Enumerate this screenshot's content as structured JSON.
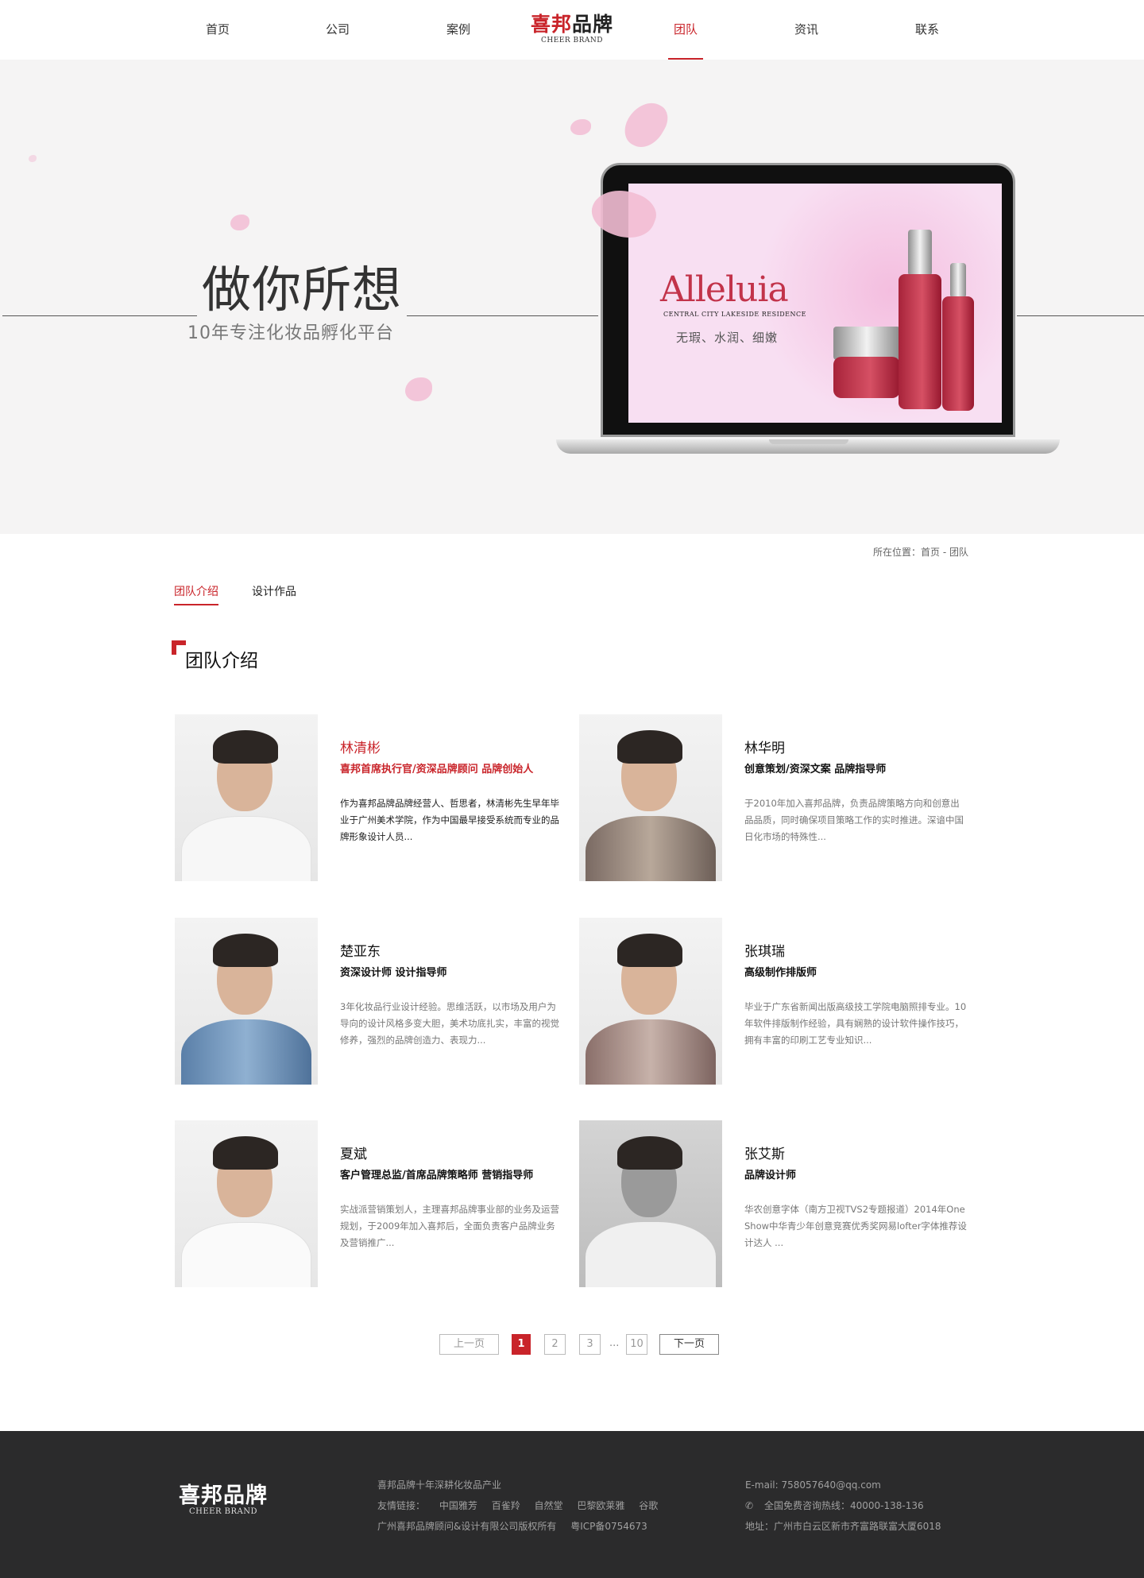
{
  "nav": {
    "items": [
      "首页",
      "公司",
      "案例",
      "团队",
      "资讯",
      "联系"
    ],
    "active_index": 3,
    "logo_cn_red": "喜邦",
    "logo_cn_dark": "品牌",
    "logo_en": "CHEER BRAND"
  },
  "hero": {
    "slogan": "做你所想",
    "subtitle": "10年专注化妆品孵化平台",
    "screen_brand": "Alleluia",
    "screen_subline": "CENTRAL CITY LAKESIDE RESIDENCE",
    "screen_tagline": "无瑕、水润、细嫩"
  },
  "breadcrumb": "所在位置：首页 - 团队",
  "tabs": [
    "团队介绍",
    "设计作品"
  ],
  "section_title": "团队介绍",
  "members": [
    {
      "name": "林清彬",
      "role": "喜邦首席执行官/资深品牌顾问  品牌创始人",
      "desc": "作为喜邦品牌品牌经营人、哲思者，林清彬先生早年毕业于广州美术学院，作为中国最早接受系统而专业的品牌形象设计人员..."
    },
    {
      "name": "林华明",
      "role": "创意策划/资深文案  品牌指导师",
      "desc": "于2010年加入喜邦品牌，负责品牌策略方向和创意出品品质，同时确保项目策略工作的实时推进。深谙中国日化市场的特殊性..."
    },
    {
      "name": "楚亚东",
      "role": "资深设计师  设计指导师",
      "desc": "3年化妆品行业设计经验。思维活跃，以市场及用户为导向的设计风格多变大胆，美术功底扎实，丰富的视觉修养，强烈的品牌创造力、表现力..."
    },
    {
      "name": "张琪瑞",
      "role": "高级制作排版师",
      "desc": "毕业于广东省新闻出版高级技工学院电脑照排专业。10年软件排版制作经验，具有娴熟的设计软件操作技巧，拥有丰富的印刷工艺专业知识..."
    },
    {
      "name": "夏斌",
      "role": "客户管理总监/首席品牌策略师  营销指导师",
      "desc": "实战派营销策划人，主理喜邦品牌事业部的业务及运营规划，于2009年加入喜邦后，全面负责客户品牌业务及营销推广..."
    },
    {
      "name": "张艾斯",
      "role": "品牌设计师",
      "desc": "华农创意字体（南方卫视TVS2专题报道）2014年One Show中华青少年创意竞赛优秀奖网易lofter字体推荐设计达人 ..."
    }
  ],
  "pagination": {
    "prev": "上一页",
    "pages": [
      "1",
      "2",
      "3"
    ],
    "ellipsis": "...",
    "last": "10",
    "next": "下一页",
    "current": "1"
  },
  "footer": {
    "logo_cn": "喜邦品牌",
    "logo_en": "CHEER BRAND",
    "tagline": "喜邦品牌十年深耕化妆品产业",
    "links_label": "友情链接：",
    "links": [
      "中国雅芳",
      "百雀羚",
      "自然堂",
      "巴黎欧莱雅",
      "谷歌"
    ],
    "copyright": "广州喜邦品牌顾问&设计有限公司版权所有",
    "icp": "粤ICP备0754673",
    "email": "E-mail: 758057640@qq.com",
    "hotline": "全国免费咨询热线：40000-138-136",
    "address": "地址：广州市白云区新市齐富路联富大厦6018"
  },
  "colors": {
    "accent": "#c9242a",
    "footer_bg": "#2b2b2c",
    "hero_bg": "#f5f4f4"
  }
}
